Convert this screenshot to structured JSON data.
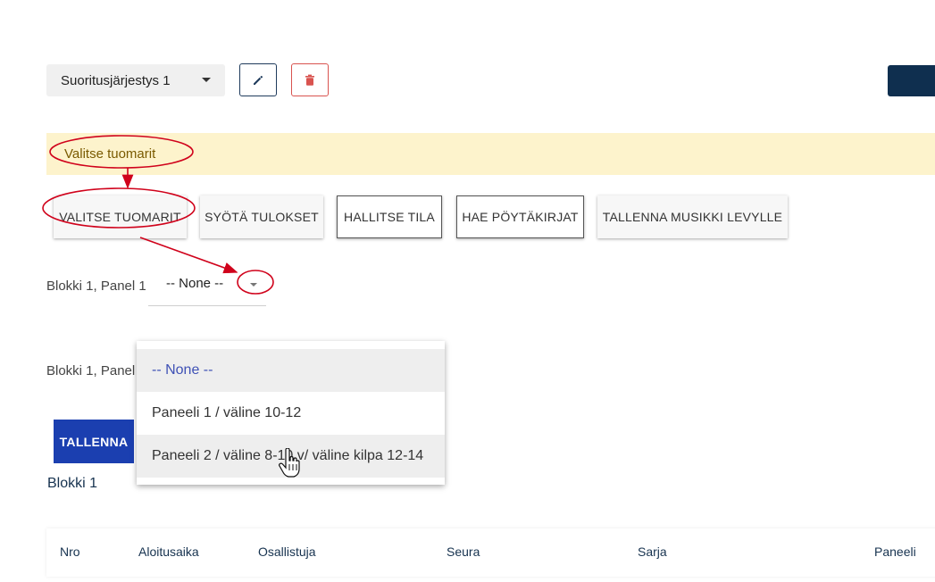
{
  "order_selector": {
    "value": "Suoritusjärjestys 1"
  },
  "alert": {
    "text": "Valitse tuomarit"
  },
  "actions": [
    {
      "label": "VALITSE TUOMARIT"
    },
    {
      "label": "SYÖTÄ TULOKSET"
    },
    {
      "label": "HALLITSE TILA"
    },
    {
      "label": "HAE PÖYTÄKIRJAT"
    },
    {
      "label": "TALLENNA MUSIKKI LEVYLLE"
    }
  ],
  "panel_rows": [
    {
      "label": "Blokki 1, Panel 1",
      "selected": "-- None --"
    },
    {
      "label": "Blokki 1, Panel"
    }
  ],
  "dropdown": {
    "options": [
      "-- None --",
      "Paneeli 1 / väline 10-12",
      "Paneeli 2 / väline 8-10 v/ väline kilpa 12-14"
    ]
  },
  "save_button": {
    "label": "TALLENNA"
  },
  "section": {
    "title": "Blokki 1"
  },
  "table": {
    "headers": [
      "Nro",
      "Aloitusaika",
      "Osallistuja",
      "Seura",
      "Sarja",
      "Paneeli"
    ]
  },
  "colors": {
    "annotation": "#d0021b",
    "primary": "#1b3fb0",
    "alert_bg": "#fdf3cc",
    "dark_navy": "#0f2f4f"
  },
  "icons": {
    "edit": "pencil-icon",
    "delete": "trash-icon",
    "cursor": "hand-pointer-icon"
  }
}
